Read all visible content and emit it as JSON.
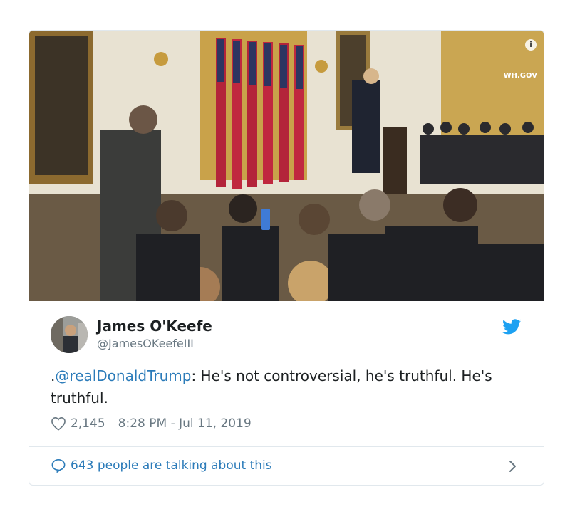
{
  "tweet": {
    "author_name": "James O'Keefe",
    "author_handle": "@JamesOKeefeIII",
    "text_prefix": ".",
    "mention": "@realDonaldTrump",
    "text_suffix": ": He's not controversial, he's truthful. He's truthful.",
    "likes": "2,145",
    "timestamp": "8:28 PM - Jul 11, 2019",
    "talking": "643 people are talking about this"
  },
  "media": {
    "watermark": "WH.GOV",
    "info_glyph": "i"
  },
  "colors": {
    "accent": "#2b7bb9",
    "twitter_blue": "#1da1f2",
    "muted": "#697882",
    "border": "#e1e8ed"
  },
  "icons": {
    "info": "info-icon",
    "twitter": "twitter-bird-icon",
    "heart": "heart-icon",
    "reply": "speech-bubble-icon",
    "chevron": "chevron-right-icon"
  }
}
